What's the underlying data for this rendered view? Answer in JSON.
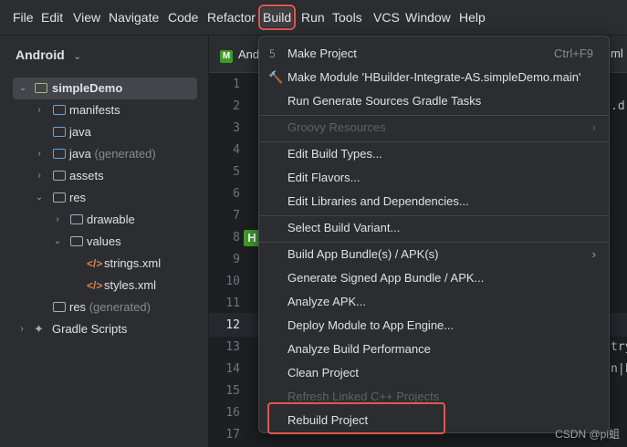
{
  "menubar": {
    "items": [
      {
        "label": "File"
      },
      {
        "label": "Edit"
      },
      {
        "label": "View"
      },
      {
        "label": "Navigate"
      },
      {
        "label": "Code"
      },
      {
        "label": "Refactor"
      },
      {
        "label": "Build",
        "active": true
      },
      {
        "label": "Run"
      },
      {
        "label": "Tools"
      },
      {
        "label": "VCS"
      },
      {
        "label": "Window"
      },
      {
        "label": "Help"
      }
    ]
  },
  "sidebar": {
    "title": "Android",
    "tree": [
      {
        "label": "simpleDemo",
        "icon": "module-folder-icon",
        "selected": true
      },
      {
        "label": "manifests",
        "icon": "folder-icon"
      },
      {
        "label": "java",
        "icon": "folder-icon"
      },
      {
        "label": "java",
        "suffix": "(generated)",
        "icon": "folder-icon"
      },
      {
        "label": "assets",
        "icon": "folder-icon"
      },
      {
        "label": "res",
        "icon": "folder-icon"
      },
      {
        "label": "drawable",
        "icon": "folder-icon"
      },
      {
        "label": "values",
        "icon": "folder-icon"
      },
      {
        "label": "strings.xml",
        "icon": "xml-file-icon"
      },
      {
        "label": "styles.xml",
        "icon": "xml-file-icon"
      },
      {
        "label": "res",
        "suffix": "(generated)",
        "icon": "folder-icon"
      },
      {
        "label": "Gradle Scripts",
        "icon": "gradle-icon"
      }
    ]
  },
  "editor": {
    "tab_fragment": "And",
    "tab_right_fragment": "ml",
    "badge_letter": "H",
    "line_numbers": [
      "1",
      "2",
      "3",
      "4",
      "5",
      "6",
      "7",
      "8",
      "9",
      "10",
      "11",
      "12",
      "13",
      "14",
      "15",
      "16",
      "17"
    ],
    "code_fragments": [
      ".d.",
      "try",
      "n|k"
    ]
  },
  "build_menu": {
    "items": [
      {
        "label": "Make Project",
        "shortcut": "Ctrl+F9",
        "icon": "hammer-icon"
      },
      {
        "label": "Make Module 'HBuilder-Integrate-AS.simpleDemo.main'",
        "icon": "module-build-icon"
      },
      {
        "label": "Run Generate Sources Gradle Tasks"
      },
      {
        "label": "Groovy Resources",
        "disabled": true,
        "submenu": true
      },
      {
        "label": "Edit Build Types..."
      },
      {
        "label": "Edit Flavors..."
      },
      {
        "label": "Edit Libraries and Dependencies..."
      },
      {
        "label": "Select Build Variant..."
      },
      {
        "label": "Build App Bundle(s) / APK(s)",
        "submenu": true
      },
      {
        "label": "Generate Signed App Bundle / APK..."
      },
      {
        "label": "Analyze APK..."
      },
      {
        "label": "Deploy Module to App Engine..."
      },
      {
        "label": "Analyze Build Performance"
      },
      {
        "label": "Clean Project"
      },
      {
        "label": "Refresh Linked C++ Projects",
        "disabled": true
      },
      {
        "label": "Rebuild Project",
        "highlighted": true
      }
    ]
  },
  "watermark": "CSDN @pi蛆",
  "colors": {
    "highlight_box": "#e0584f",
    "menubar_bg": "#2b2d30",
    "editor_bg": "#1e1f22",
    "badge_green": "#3f9b2a"
  }
}
